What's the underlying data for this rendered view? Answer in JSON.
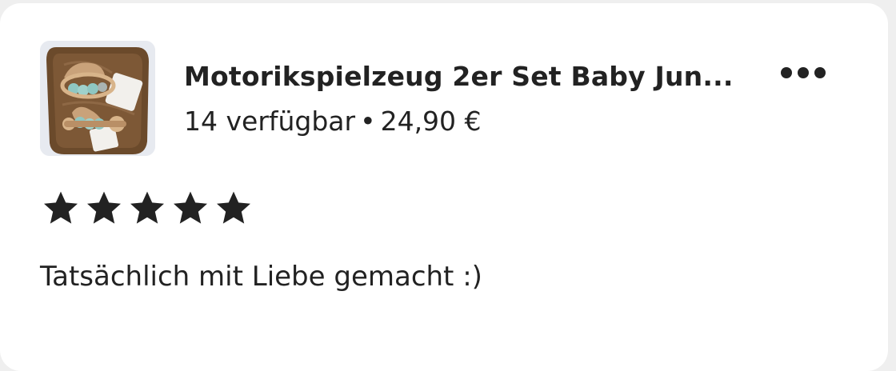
{
  "listing": {
    "title": "Motorikspielzeug 2er Set Baby Jun...",
    "availability": "14 verfügbar",
    "separator": "•",
    "price": "24,90 €",
    "thumbnail_icon": "product-photo"
  },
  "menu": {
    "icon": "more-horizontal-icon"
  },
  "review": {
    "rating": 5,
    "rating_max": 5,
    "text": "Tatsächlich mit Liebe gemacht :)"
  },
  "colors": {
    "text": "#222222",
    "card_background": "#ffffff",
    "page_background": "#efefef"
  }
}
